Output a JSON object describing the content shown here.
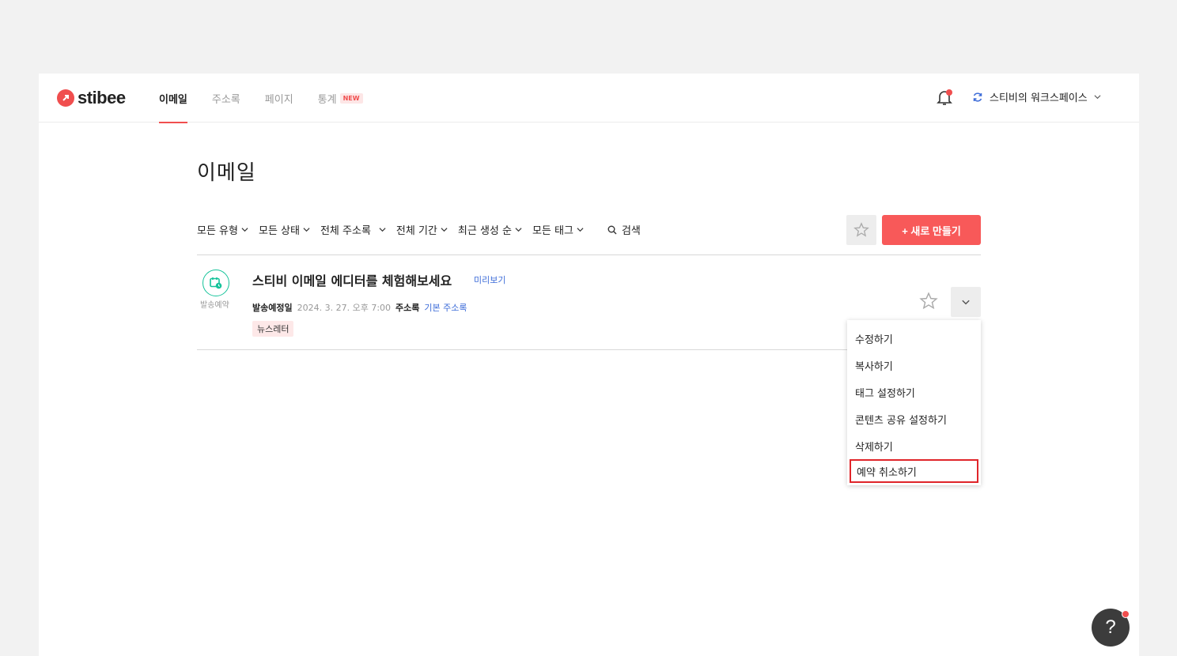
{
  "brand": {
    "logo_text": "stibee",
    "accent": "#f04e4e"
  },
  "nav": {
    "items": [
      {
        "label": "이메일",
        "active": true
      },
      {
        "label": "주소록",
        "active": false
      },
      {
        "label": "페이지",
        "active": false
      },
      {
        "label": "통계",
        "active": false,
        "badge": "NEW"
      }
    ]
  },
  "header": {
    "workspace": "스티비의 워크스페이스"
  },
  "main": {
    "title": "이메일",
    "filters": [
      "모든 유형",
      "모든 상태",
      "전체 주소록",
      "전체 기간",
      "최근 생성 순",
      "모든 태그"
    ],
    "search_label": "검색",
    "new_button": "+ 새로 만들기"
  },
  "email": {
    "status": "발송예약",
    "title": "스티비 이메일 에디터를 체험해보세요",
    "preview": "미리보기",
    "scheduled_label": "발송예정일",
    "scheduled_value": "2024. 3. 27. 오후 7:00",
    "address_label": "주소록",
    "address_value": "기본 주소록",
    "tag": "뉴스레터"
  },
  "menu": {
    "items": [
      "수정하기",
      "복사하기",
      "태그 설정하기",
      "콘텐츠 공유 설정하기",
      "삭제하기",
      "예약 취소하기"
    ]
  },
  "help": {
    "label": "?"
  }
}
